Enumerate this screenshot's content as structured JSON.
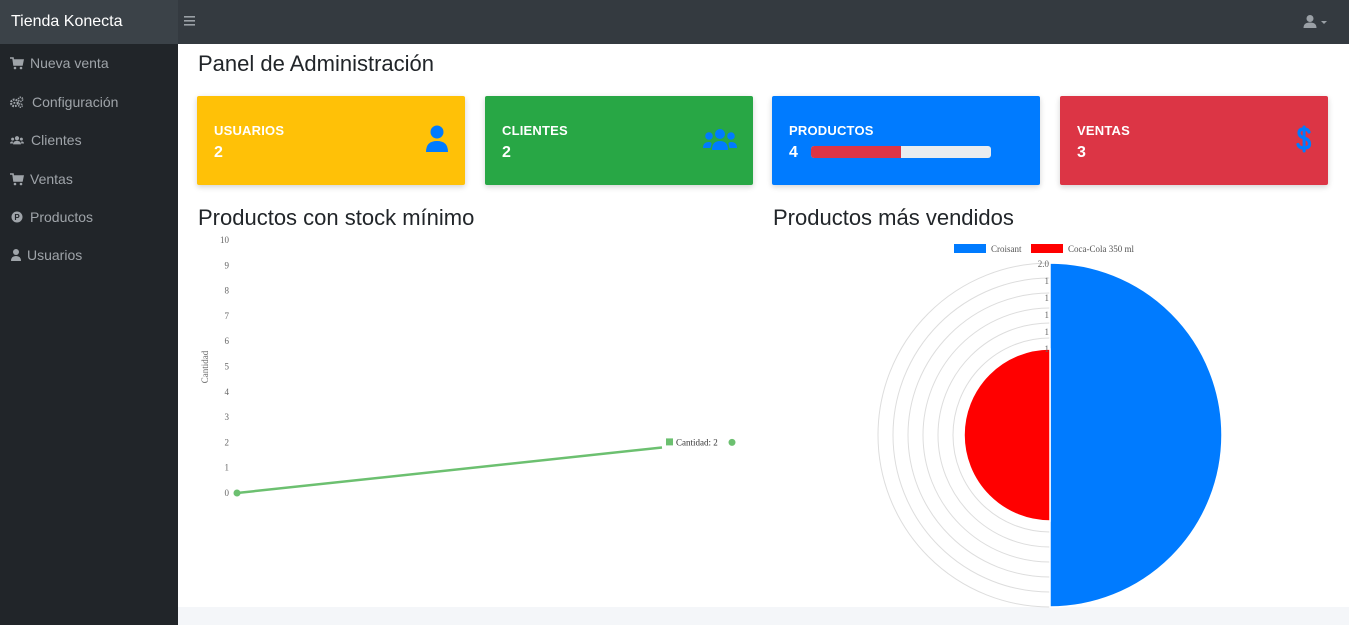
{
  "app": {
    "title": "Tienda Konecta"
  },
  "sidebar": {
    "items": [
      {
        "label": "Nueva venta",
        "icon": "cart-icon"
      },
      {
        "label": "Configuración",
        "icon": "cogs-icon"
      },
      {
        "label": "Clientes",
        "icon": "users-icon"
      },
      {
        "label": "Ventas",
        "icon": "cart-icon"
      },
      {
        "label": "Productos",
        "icon": "product-icon"
      },
      {
        "label": "Usuarios",
        "icon": "user-icon"
      }
    ]
  },
  "page": {
    "title": "Panel de Administración"
  },
  "cards": [
    {
      "title": "USUARIOS",
      "value": "2",
      "color": "#ffc107",
      "text_color": "#ffffff",
      "icon": "user-icon",
      "icon_color": "#007bff"
    },
    {
      "title": "CLIENTES",
      "value": "2",
      "color": "#28a745",
      "text_color": "#ffffff",
      "icon": "users-icon",
      "icon_color": "#007bff"
    },
    {
      "title": "PRODUCTOS",
      "value": "4",
      "color": "#007bff",
      "text_color": "#ffffff",
      "progress_fraction": 0.5,
      "progress_color": "#dc3545"
    },
    {
      "title": "VENTAS",
      "value": "3",
      "color": "#dc3545",
      "text_color": "#ffffff",
      "icon": "dollar-icon",
      "icon_color": "#007bff"
    }
  ],
  "sections": {
    "stock_title": "Productos con stock mínimo",
    "sold_title": "Productos más vendidos"
  },
  "chart_data": [
    {
      "type": "line",
      "title": "Productos con stock mínimo",
      "ylabel": "Cantidad",
      "yticks": [
        "0",
        "1",
        "2",
        "3",
        "4",
        "5",
        "6",
        "7",
        "8",
        "9",
        "10"
      ],
      "ylim": [
        0,
        10
      ],
      "series": [
        {
          "name": "Cantidad",
          "color": "#6cc070",
          "values": [
            0,
            2
          ]
        }
      ],
      "tooltip": "Cantidad: 2",
      "grid": false
    },
    {
      "type": "pie",
      "subtype": "polarArea",
      "title": "Productos más vendidos",
      "labels": [
        "Croisant",
        "Coca-Cola 350 ml"
      ],
      "values": [
        2,
        1
      ],
      "colors": [
        "#007bff",
        "#ff0000"
      ],
      "rlim": [
        0,
        2
      ],
      "tick_labels": [
        "2.0",
        "1",
        "1",
        "1",
        "1",
        "1"
      ],
      "legend": "top"
    }
  ]
}
